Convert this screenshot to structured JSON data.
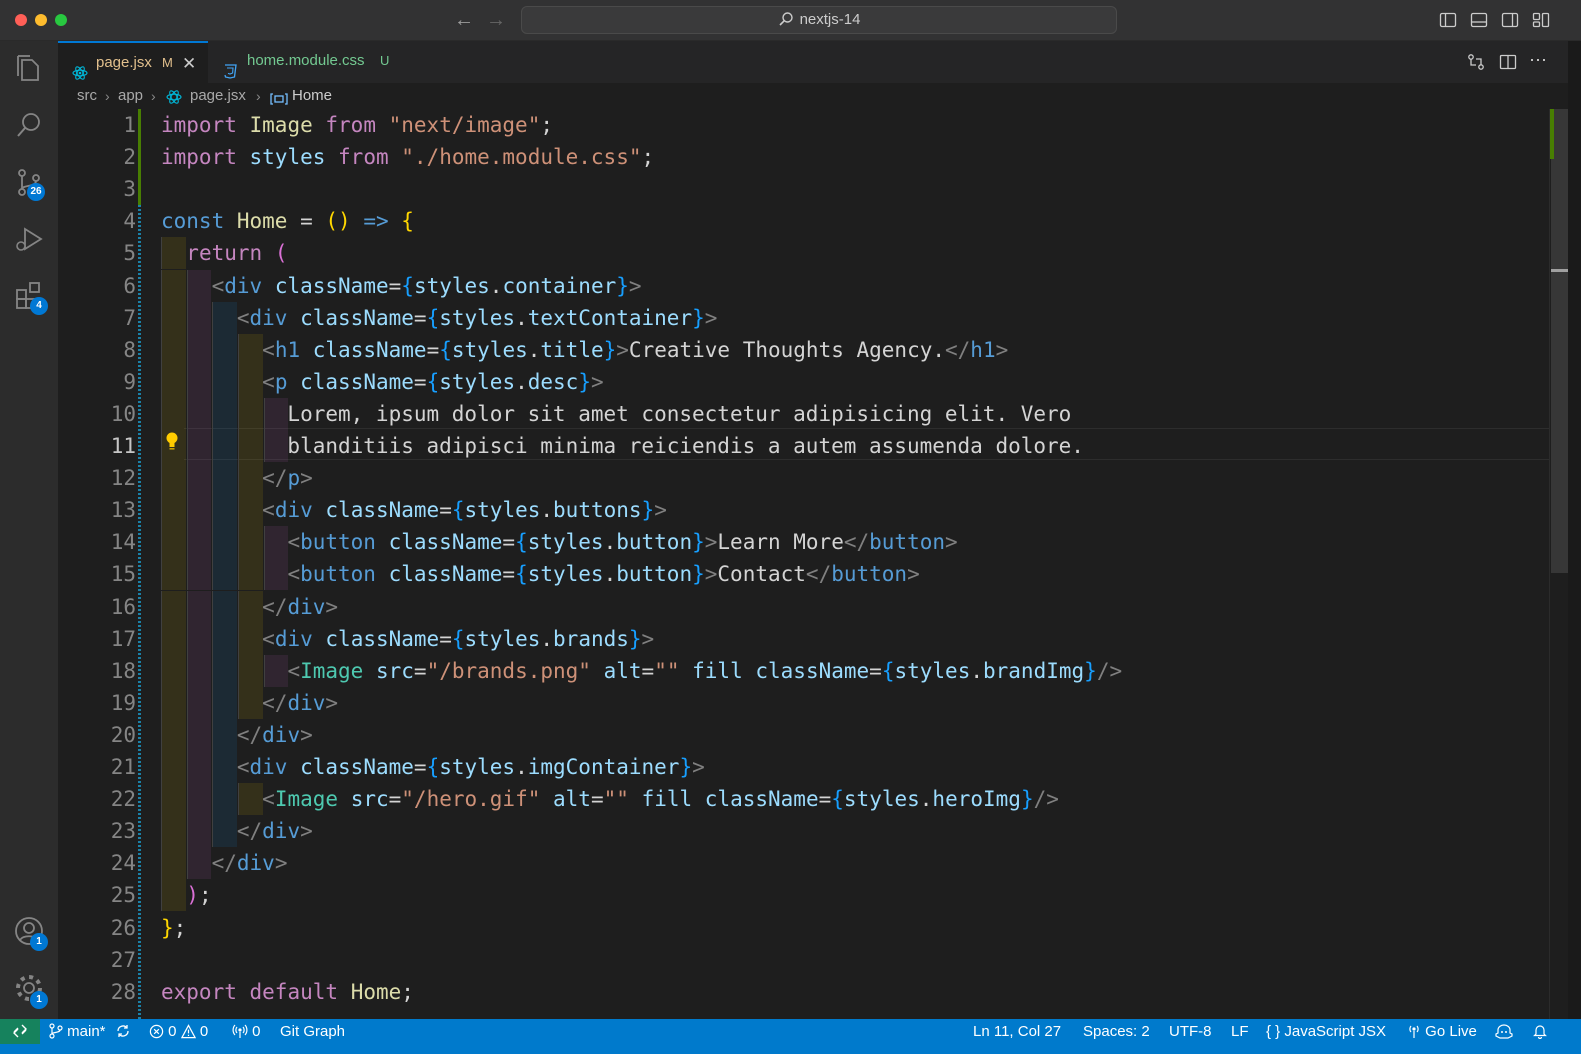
{
  "titlebar": {
    "search_text": "nextjs-14"
  },
  "activity": {
    "source_control_badge": "26",
    "extensions_badge": "4",
    "accounts_badge": "1",
    "manage_badge": "1"
  },
  "tabs": [
    {
      "label": "page.jsx",
      "status": "M",
      "active": true
    },
    {
      "label": "home.module.css",
      "status": "U",
      "active": false
    }
  ],
  "breadcrumbs": [
    "src",
    "app",
    "page.jsx",
    "Home"
  ],
  "editor": {
    "active_line": 11,
    "line_numbers": [
      "1",
      "2",
      "3",
      "4",
      "5",
      "6",
      "7",
      "8",
      "9",
      "10",
      "11",
      "12",
      "13",
      "14",
      "15",
      "16",
      "17",
      "18",
      "19",
      "20",
      "21",
      "22",
      "23",
      "24",
      "25",
      "26",
      "27",
      "28"
    ],
    "lines": [
      [
        [
          "kw",
          "import"
        ],
        [
          "tx",
          " "
        ],
        [
          "fn",
          "Image"
        ],
        [
          "tx",
          " "
        ],
        [
          "kw",
          "from"
        ],
        [
          "tx",
          " "
        ],
        [
          "str",
          "\"next/image\""
        ],
        [
          "tx",
          ";"
        ]
      ],
      [
        [
          "kw",
          "import"
        ],
        [
          "tx",
          " "
        ],
        [
          "vr",
          "styles"
        ],
        [
          "tx",
          " "
        ],
        [
          "kw",
          "from"
        ],
        [
          "tx",
          " "
        ],
        [
          "str",
          "\"./home.module.css\""
        ],
        [
          "tx",
          ";"
        ]
      ],
      [],
      [
        [
          "st",
          "const"
        ],
        [
          "tx",
          " "
        ],
        [
          "fn",
          "Home"
        ],
        [
          "tx",
          " = "
        ],
        [
          "b1",
          "()"
        ],
        [
          "tx",
          " "
        ],
        [
          "st",
          "=>"
        ],
        [
          "tx",
          " "
        ],
        [
          "b1",
          "{"
        ]
      ],
      [
        [
          "tx",
          "  "
        ],
        [
          "kw",
          "return"
        ],
        [
          "tx",
          " "
        ],
        [
          "b2",
          "("
        ]
      ],
      [
        [
          "tx",
          "    "
        ],
        [
          "pn",
          "<"
        ],
        [
          "tg",
          "div"
        ],
        [
          "tx",
          " "
        ],
        [
          "vr",
          "className"
        ],
        [
          "tx",
          "="
        ],
        [
          "b3",
          "{"
        ],
        [
          "vr",
          "styles"
        ],
        [
          "tx",
          "."
        ],
        [
          "vr",
          "container"
        ],
        [
          "b3",
          "}"
        ],
        [
          "pn",
          ">"
        ]
      ],
      [
        [
          "tx",
          "      "
        ],
        [
          "pn",
          "<"
        ],
        [
          "tg",
          "div"
        ],
        [
          "tx",
          " "
        ],
        [
          "vr",
          "className"
        ],
        [
          "tx",
          "="
        ],
        [
          "b3",
          "{"
        ],
        [
          "vr",
          "styles"
        ],
        [
          "tx",
          "."
        ],
        [
          "vr",
          "textContainer"
        ],
        [
          "b3",
          "}"
        ],
        [
          "pn",
          ">"
        ]
      ],
      [
        [
          "tx",
          "        "
        ],
        [
          "pn",
          "<"
        ],
        [
          "tg",
          "h1"
        ],
        [
          "tx",
          " "
        ],
        [
          "vr",
          "className"
        ],
        [
          "tx",
          "="
        ],
        [
          "b3",
          "{"
        ],
        [
          "vr",
          "styles"
        ],
        [
          "tx",
          "."
        ],
        [
          "vr",
          "title"
        ],
        [
          "b3",
          "}"
        ],
        [
          "pn",
          ">"
        ],
        [
          "tx",
          "Creative Thoughts Agency."
        ],
        [
          "pn",
          "</"
        ],
        [
          "tg",
          "h1"
        ],
        [
          "pn",
          ">"
        ]
      ],
      [
        [
          "tx",
          "        "
        ],
        [
          "pn",
          "<"
        ],
        [
          "tg",
          "p"
        ],
        [
          "tx",
          " "
        ],
        [
          "vr",
          "className"
        ],
        [
          "tx",
          "="
        ],
        [
          "b3",
          "{"
        ],
        [
          "vr",
          "styles"
        ],
        [
          "tx",
          "."
        ],
        [
          "vr",
          "desc"
        ],
        [
          "b3",
          "}"
        ],
        [
          "pn",
          ">"
        ]
      ],
      [
        [
          "tx",
          "          Lorem, ipsum dolor sit amet consectetur adipisicing elit. Vero"
        ]
      ],
      [
        [
          "tx",
          "          blanditiis adipisci minima reiciendis a autem assumenda dolore."
        ]
      ],
      [
        [
          "tx",
          "        "
        ],
        [
          "pn",
          "</"
        ],
        [
          "tg",
          "p"
        ],
        [
          "pn",
          ">"
        ]
      ],
      [
        [
          "tx",
          "        "
        ],
        [
          "pn",
          "<"
        ],
        [
          "tg",
          "div"
        ],
        [
          "tx",
          " "
        ],
        [
          "vr",
          "className"
        ],
        [
          "tx",
          "="
        ],
        [
          "b3",
          "{"
        ],
        [
          "vr",
          "styles"
        ],
        [
          "tx",
          "."
        ],
        [
          "vr",
          "buttons"
        ],
        [
          "b3",
          "}"
        ],
        [
          "pn",
          ">"
        ]
      ],
      [
        [
          "tx",
          "          "
        ],
        [
          "pn",
          "<"
        ],
        [
          "tg",
          "button"
        ],
        [
          "tx",
          " "
        ],
        [
          "vr",
          "className"
        ],
        [
          "tx",
          "="
        ],
        [
          "b3",
          "{"
        ],
        [
          "vr",
          "styles"
        ],
        [
          "tx",
          "."
        ],
        [
          "vr",
          "button"
        ],
        [
          "b3",
          "}"
        ],
        [
          "pn",
          ">"
        ],
        [
          "tx",
          "Learn More"
        ],
        [
          "pn",
          "</"
        ],
        [
          "tg",
          "button"
        ],
        [
          "pn",
          ">"
        ]
      ],
      [
        [
          "tx",
          "          "
        ],
        [
          "pn",
          "<"
        ],
        [
          "tg",
          "button"
        ],
        [
          "tx",
          " "
        ],
        [
          "vr",
          "className"
        ],
        [
          "tx",
          "="
        ],
        [
          "b3",
          "{"
        ],
        [
          "vr",
          "styles"
        ],
        [
          "tx",
          "."
        ],
        [
          "vr",
          "button"
        ],
        [
          "b3",
          "}"
        ],
        [
          "pn",
          ">"
        ],
        [
          "tx",
          "Contact"
        ],
        [
          "pn",
          "</"
        ],
        [
          "tg",
          "button"
        ],
        [
          "pn",
          ">"
        ]
      ],
      [
        [
          "tx",
          "        "
        ],
        [
          "pn",
          "</"
        ],
        [
          "tg",
          "div"
        ],
        [
          "pn",
          ">"
        ]
      ],
      [
        [
          "tx",
          "        "
        ],
        [
          "pn",
          "<"
        ],
        [
          "tg",
          "div"
        ],
        [
          "tx",
          " "
        ],
        [
          "vr",
          "className"
        ],
        [
          "tx",
          "="
        ],
        [
          "b3",
          "{"
        ],
        [
          "vr",
          "styles"
        ],
        [
          "tx",
          "."
        ],
        [
          "vr",
          "brands"
        ],
        [
          "b3",
          "}"
        ],
        [
          "pn",
          ">"
        ]
      ],
      [
        [
          "tx",
          "          "
        ],
        [
          "pn",
          "<"
        ],
        [
          "cm",
          "Image"
        ],
        [
          "tx",
          " "
        ],
        [
          "vr",
          "src"
        ],
        [
          "tx",
          "="
        ],
        [
          "str",
          "\"/brands.png\""
        ],
        [
          "tx",
          " "
        ],
        [
          "vr",
          "alt"
        ],
        [
          "tx",
          "="
        ],
        [
          "str",
          "\"\""
        ],
        [
          "tx",
          " "
        ],
        [
          "vr",
          "fill"
        ],
        [
          "tx",
          " "
        ],
        [
          "vr",
          "className"
        ],
        [
          "tx",
          "="
        ],
        [
          "b3",
          "{"
        ],
        [
          "vr",
          "styles"
        ],
        [
          "tx",
          "."
        ],
        [
          "vr",
          "brandImg"
        ],
        [
          "b3",
          "}"
        ],
        [
          "pn",
          "/>"
        ]
      ],
      [
        [
          "tx",
          "        "
        ],
        [
          "pn",
          "</"
        ],
        [
          "tg",
          "div"
        ],
        [
          "pn",
          ">"
        ]
      ],
      [
        [
          "tx",
          "      "
        ],
        [
          "pn",
          "</"
        ],
        [
          "tg",
          "div"
        ],
        [
          "pn",
          ">"
        ]
      ],
      [
        [
          "tx",
          "      "
        ],
        [
          "pn",
          "<"
        ],
        [
          "tg",
          "div"
        ],
        [
          "tx",
          " "
        ],
        [
          "vr",
          "className"
        ],
        [
          "tx",
          "="
        ],
        [
          "b3",
          "{"
        ],
        [
          "vr",
          "styles"
        ],
        [
          "tx",
          "."
        ],
        [
          "vr",
          "imgContainer"
        ],
        [
          "b3",
          "}"
        ],
        [
          "pn",
          ">"
        ]
      ],
      [
        [
          "tx",
          "        "
        ],
        [
          "pn",
          "<"
        ],
        [
          "cm",
          "Image"
        ],
        [
          "tx",
          " "
        ],
        [
          "vr",
          "src"
        ],
        [
          "tx",
          "="
        ],
        [
          "str",
          "\"/hero.gif\""
        ],
        [
          "tx",
          " "
        ],
        [
          "vr",
          "alt"
        ],
        [
          "tx",
          "="
        ],
        [
          "str",
          "\"\""
        ],
        [
          "tx",
          " "
        ],
        [
          "vr",
          "fill"
        ],
        [
          "tx",
          " "
        ],
        [
          "vr",
          "className"
        ],
        [
          "tx",
          "="
        ],
        [
          "b3",
          "{"
        ],
        [
          "vr",
          "styles"
        ],
        [
          "tx",
          "."
        ],
        [
          "vr",
          "heroImg"
        ],
        [
          "b3",
          "}"
        ],
        [
          "pn",
          "/>"
        ]
      ],
      [
        [
          "tx",
          "      "
        ],
        [
          "pn",
          "</"
        ],
        [
          "tg",
          "div"
        ],
        [
          "pn",
          ">"
        ]
      ],
      [
        [
          "tx",
          "    "
        ],
        [
          "pn",
          "</"
        ],
        [
          "tg",
          "div"
        ],
        [
          "pn",
          ">"
        ]
      ],
      [
        [
          "tx",
          "  "
        ],
        [
          "b2",
          ")"
        ],
        [
          "tx",
          ";"
        ]
      ],
      [
        [
          "b1",
          "}"
        ],
        [
          "tx",
          ";"
        ]
      ],
      [],
      [
        [
          "kw",
          "export"
        ],
        [
          "tx",
          " "
        ],
        [
          "kw",
          "default"
        ],
        [
          "tx",
          " "
        ],
        [
          "fn",
          "Home"
        ],
        [
          "tx",
          ";"
        ]
      ]
    ]
  },
  "statusbar": {
    "branch": "main*",
    "errors": "0",
    "warnings": "0",
    "ports": "0",
    "git_graph": "Git Graph",
    "cursor": "Ln 11, Col 27",
    "spaces": "Spaces: 2",
    "encoding": "UTF-8",
    "eol": "LF",
    "language": "JavaScript JSX",
    "go_live": "Go Live"
  },
  "colors": {
    "accent": "#007acc",
    "remote": "#16825d",
    "modified": "#e2c08d",
    "untracked": "#73c991"
  }
}
